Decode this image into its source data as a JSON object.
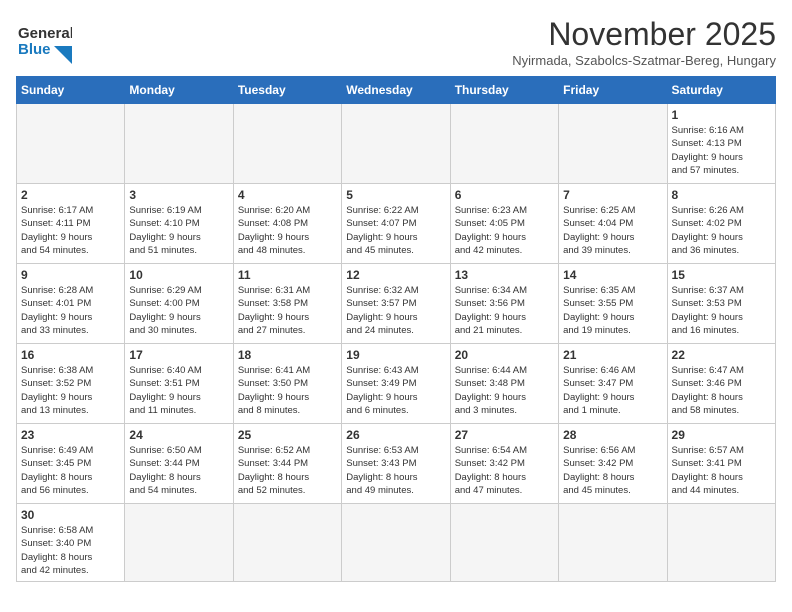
{
  "header": {
    "logo_general": "General",
    "logo_blue": "Blue",
    "month_title": "November 2025",
    "location": "Nyirmada, Szabolcs-Szatmar-Bereg, Hungary"
  },
  "weekdays": [
    "Sunday",
    "Monday",
    "Tuesday",
    "Wednesday",
    "Thursday",
    "Friday",
    "Saturday"
  ],
  "weeks": [
    [
      {
        "day": "",
        "info": ""
      },
      {
        "day": "",
        "info": ""
      },
      {
        "day": "",
        "info": ""
      },
      {
        "day": "",
        "info": ""
      },
      {
        "day": "",
        "info": ""
      },
      {
        "day": "",
        "info": ""
      },
      {
        "day": "1",
        "info": "Sunrise: 6:16 AM\nSunset: 4:13 PM\nDaylight: 9 hours\nand 57 minutes."
      }
    ],
    [
      {
        "day": "2",
        "info": "Sunrise: 6:17 AM\nSunset: 4:11 PM\nDaylight: 9 hours\nand 54 minutes."
      },
      {
        "day": "3",
        "info": "Sunrise: 6:19 AM\nSunset: 4:10 PM\nDaylight: 9 hours\nand 51 minutes."
      },
      {
        "day": "4",
        "info": "Sunrise: 6:20 AM\nSunset: 4:08 PM\nDaylight: 9 hours\nand 48 minutes."
      },
      {
        "day": "5",
        "info": "Sunrise: 6:22 AM\nSunset: 4:07 PM\nDaylight: 9 hours\nand 45 minutes."
      },
      {
        "day": "6",
        "info": "Sunrise: 6:23 AM\nSunset: 4:05 PM\nDaylight: 9 hours\nand 42 minutes."
      },
      {
        "day": "7",
        "info": "Sunrise: 6:25 AM\nSunset: 4:04 PM\nDaylight: 9 hours\nand 39 minutes."
      },
      {
        "day": "8",
        "info": "Sunrise: 6:26 AM\nSunset: 4:02 PM\nDaylight: 9 hours\nand 36 minutes."
      }
    ],
    [
      {
        "day": "9",
        "info": "Sunrise: 6:28 AM\nSunset: 4:01 PM\nDaylight: 9 hours\nand 33 minutes."
      },
      {
        "day": "10",
        "info": "Sunrise: 6:29 AM\nSunset: 4:00 PM\nDaylight: 9 hours\nand 30 minutes."
      },
      {
        "day": "11",
        "info": "Sunrise: 6:31 AM\nSunset: 3:58 PM\nDaylight: 9 hours\nand 27 minutes."
      },
      {
        "day": "12",
        "info": "Sunrise: 6:32 AM\nSunset: 3:57 PM\nDaylight: 9 hours\nand 24 minutes."
      },
      {
        "day": "13",
        "info": "Sunrise: 6:34 AM\nSunset: 3:56 PM\nDaylight: 9 hours\nand 21 minutes."
      },
      {
        "day": "14",
        "info": "Sunrise: 6:35 AM\nSunset: 3:55 PM\nDaylight: 9 hours\nand 19 minutes."
      },
      {
        "day": "15",
        "info": "Sunrise: 6:37 AM\nSunset: 3:53 PM\nDaylight: 9 hours\nand 16 minutes."
      }
    ],
    [
      {
        "day": "16",
        "info": "Sunrise: 6:38 AM\nSunset: 3:52 PM\nDaylight: 9 hours\nand 13 minutes."
      },
      {
        "day": "17",
        "info": "Sunrise: 6:40 AM\nSunset: 3:51 PM\nDaylight: 9 hours\nand 11 minutes."
      },
      {
        "day": "18",
        "info": "Sunrise: 6:41 AM\nSunset: 3:50 PM\nDaylight: 9 hours\nand 8 minutes."
      },
      {
        "day": "19",
        "info": "Sunrise: 6:43 AM\nSunset: 3:49 PM\nDaylight: 9 hours\nand 6 minutes."
      },
      {
        "day": "20",
        "info": "Sunrise: 6:44 AM\nSunset: 3:48 PM\nDaylight: 9 hours\nand 3 minutes."
      },
      {
        "day": "21",
        "info": "Sunrise: 6:46 AM\nSunset: 3:47 PM\nDaylight: 9 hours\nand 1 minute."
      },
      {
        "day": "22",
        "info": "Sunrise: 6:47 AM\nSunset: 3:46 PM\nDaylight: 8 hours\nand 58 minutes."
      }
    ],
    [
      {
        "day": "23",
        "info": "Sunrise: 6:49 AM\nSunset: 3:45 PM\nDaylight: 8 hours\nand 56 minutes."
      },
      {
        "day": "24",
        "info": "Sunrise: 6:50 AM\nSunset: 3:44 PM\nDaylight: 8 hours\nand 54 minutes."
      },
      {
        "day": "25",
        "info": "Sunrise: 6:52 AM\nSunset: 3:44 PM\nDaylight: 8 hours\nand 52 minutes."
      },
      {
        "day": "26",
        "info": "Sunrise: 6:53 AM\nSunset: 3:43 PM\nDaylight: 8 hours\nand 49 minutes."
      },
      {
        "day": "27",
        "info": "Sunrise: 6:54 AM\nSunset: 3:42 PM\nDaylight: 8 hours\nand 47 minutes."
      },
      {
        "day": "28",
        "info": "Sunrise: 6:56 AM\nSunset: 3:42 PM\nDaylight: 8 hours\nand 45 minutes."
      },
      {
        "day": "29",
        "info": "Sunrise: 6:57 AM\nSunset: 3:41 PM\nDaylight: 8 hours\nand 44 minutes."
      }
    ],
    [
      {
        "day": "30",
        "info": "Sunrise: 6:58 AM\nSunset: 3:40 PM\nDaylight: 8 hours\nand 42 minutes."
      },
      {
        "day": "",
        "info": ""
      },
      {
        "day": "",
        "info": ""
      },
      {
        "day": "",
        "info": ""
      },
      {
        "day": "",
        "info": ""
      },
      {
        "day": "",
        "info": ""
      },
      {
        "day": "",
        "info": ""
      }
    ]
  ]
}
